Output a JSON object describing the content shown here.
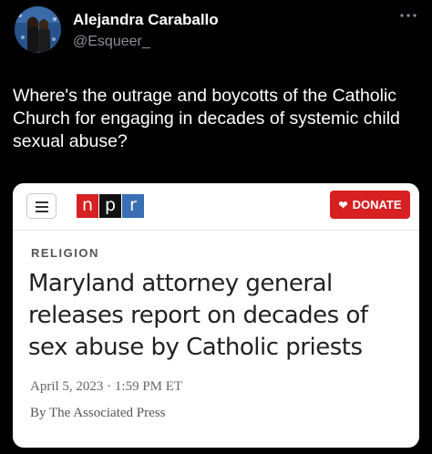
{
  "author": {
    "name": "Alejandra Caraballo",
    "handle": "@Esqueer_"
  },
  "post": {
    "text": "Where's the outrage and boycotts of the Catholic Church for engaging in decades of systemic child sexual abuse?"
  },
  "card": {
    "logo_letters": [
      "n",
      "p",
      "r"
    ],
    "donate_label": "DONATE",
    "section": "RELIGION",
    "headline": "Maryland attorney general releases report on decades of sex abuse by Catholic priests",
    "dateline": "April 5, 2023 · 1:59 PM ET",
    "byline": "By The Associated Press"
  },
  "icons": {
    "more": "more-horizontal-icon",
    "menu": "hamburger-menu-icon",
    "donate": "heart-icon"
  },
  "colors": {
    "background": "#000000",
    "handle_text": "#8b8f95",
    "npr_red": "#d62021",
    "npr_black": "#111111",
    "npr_blue": "#3a6fb5",
    "donate_red": "#d62021"
  }
}
